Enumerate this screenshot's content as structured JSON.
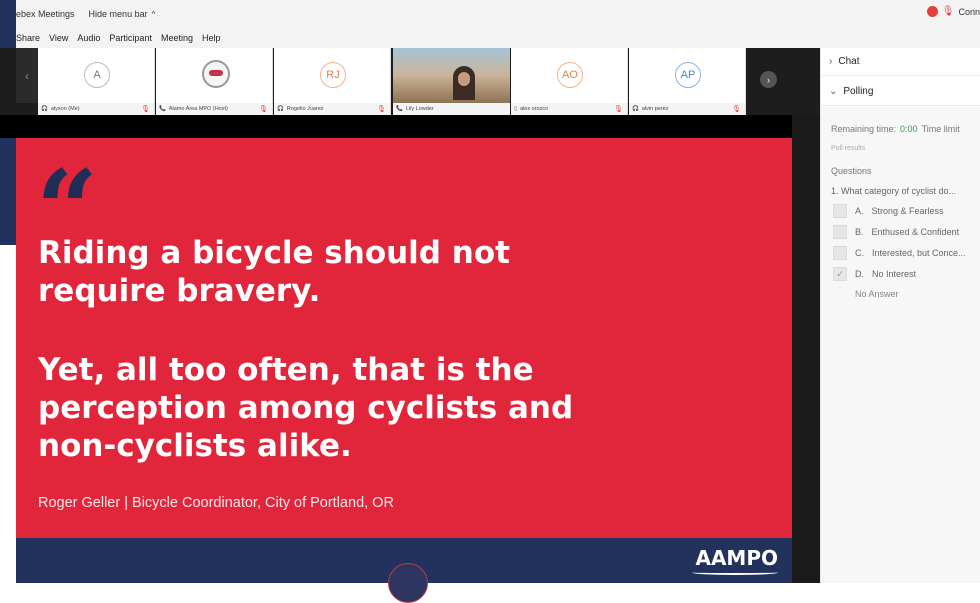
{
  "titlebar": {
    "app_title": "ebex Meetings",
    "hide_menu": "Hide menu bar",
    "right_status": "Conn"
  },
  "menu": [
    "Share",
    "View",
    "Audio",
    "Participant",
    "Meeting",
    "Help"
  ],
  "participants": [
    {
      "initials": "A",
      "name": "alyson (Me)",
      "style": "gray"
    },
    {
      "initials": "",
      "name": "Alamo Area MPO (Host)",
      "style": "logo"
    },
    {
      "initials": "RJ",
      "name": "Rogelio Juarez",
      "style": "orange"
    },
    {
      "initials": "",
      "name": "Lily Lowder",
      "style": "video"
    },
    {
      "initials": "AO",
      "name": "alex orozco",
      "style": "orange"
    },
    {
      "initials": "AP",
      "name": "alvin perez",
      "style": "blue"
    }
  ],
  "slide": {
    "quote_mark": "“",
    "line1": "Riding a bicycle should not\nrequire bravery.",
    "line2": "Yet, all too often, that is the\nperception among cyclists and\nnon-cyclists alike.",
    "attribution": "Roger Geller | Bicycle Coordinator, City of Portland, OR",
    "logo": "AAMPO",
    "bg_color": "#e1253a",
    "footer_color": "#23325c"
  },
  "panel": {
    "chat_label": "Chat",
    "polling_label": "Polling",
    "remaining_label": "Remaining time:",
    "remaining_value": "0:00",
    "time_limit": "Time limit",
    "poll_results": "Poll results",
    "questions_heading": "Questions",
    "question": "1.  What category of cyclist do...",
    "options": [
      {
        "letter": "A.",
        "text": "Strong & Fearless",
        "checked": false
      },
      {
        "letter": "B.",
        "text": "Enthused & Confident",
        "checked": false
      },
      {
        "letter": "C.",
        "text": "Interested, but Conce...",
        "checked": false
      },
      {
        "letter": "D.",
        "text": "No Interest",
        "checked": true
      }
    ],
    "no_answer": "No Answer"
  }
}
